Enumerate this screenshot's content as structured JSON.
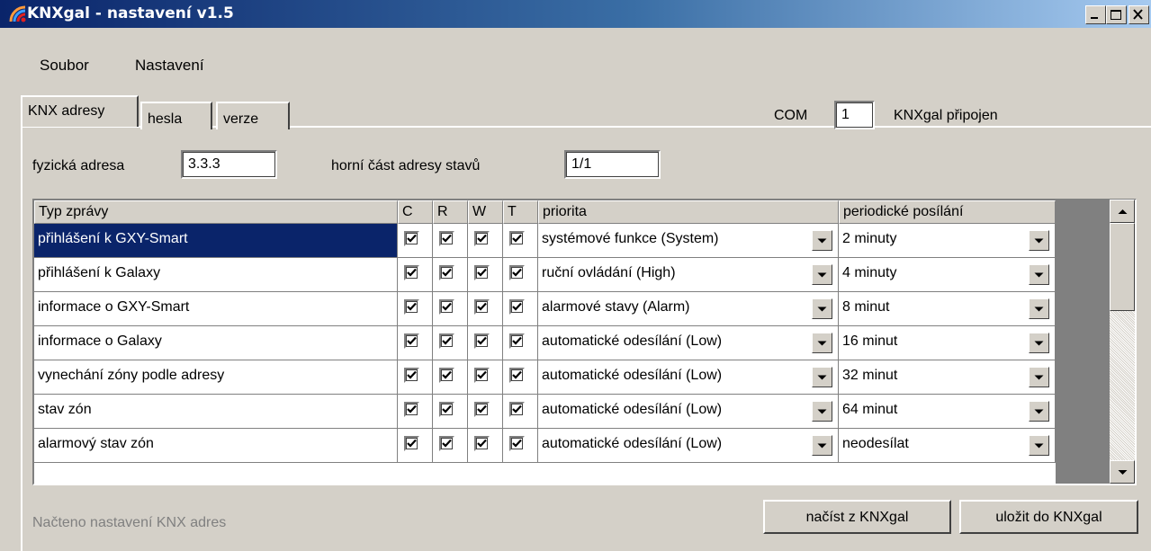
{
  "window": {
    "title": "KNXgal - nastavení v1.5"
  },
  "menu": {
    "items": [
      "Soubor",
      "Nastavení"
    ]
  },
  "tabs": [
    {
      "label": "KNX adresy",
      "active": true
    },
    {
      "label": "hesla",
      "active": false
    },
    {
      "label": "verze",
      "active": false
    }
  ],
  "connection": {
    "com_label": "COM",
    "com_value": "1",
    "status": "KNXgal připojen"
  },
  "fields": {
    "physical_address": {
      "label": "fyzická adresa",
      "value": "3.3.3"
    },
    "state_address_top": {
      "label": "horní část adresy stavů",
      "value": "1/1"
    }
  },
  "grid": {
    "columns": [
      "Typ zprávy",
      "C",
      "R",
      "W",
      "T",
      "priorita",
      "periodické posílání"
    ],
    "rows": [
      {
        "type": "přihlášení k GXY-Smart",
        "C": true,
        "R": true,
        "W": true,
        "T": true,
        "priority": "systémové funkce (System)",
        "period": "2 minuty",
        "selected": true
      },
      {
        "type": "přihlášení k Galaxy",
        "C": true,
        "R": true,
        "W": true,
        "T": true,
        "priority": "ruční ovládání (High)",
        "period": "4 minuty",
        "selected": false
      },
      {
        "type": "informace o GXY-Smart",
        "C": true,
        "R": true,
        "W": true,
        "T": true,
        "priority": "alarmové stavy (Alarm)",
        "period": "8 minut",
        "selected": false
      },
      {
        "type": "informace o Galaxy",
        "C": true,
        "R": true,
        "W": true,
        "T": true,
        "priority": "automatické odesílání (Low)",
        "period": "16 minut",
        "selected": false
      },
      {
        "type": "vynechání zóny podle adresy",
        "C": true,
        "R": true,
        "W": true,
        "T": true,
        "priority": "automatické odesílání (Low)",
        "period": "32 minut",
        "selected": false
      },
      {
        "type": "stav zón",
        "C": true,
        "R": true,
        "W": true,
        "T": true,
        "priority": "automatické odesílání (Low)",
        "period": "64 minut",
        "selected": false
      },
      {
        "type": "alarmový stav zón",
        "C": true,
        "R": true,
        "W": true,
        "T": true,
        "priority": "automatické odesílání (Low)",
        "period": "neodesílat",
        "selected": false
      }
    ]
  },
  "buttons": {
    "load": "načíst z KNXgal",
    "save": "uložit do KNXgal"
  },
  "status": {
    "text": "Načteno nastavení KNX adres"
  },
  "colors": {
    "title_start": "#0a246a",
    "title_end": "#a6caf0",
    "selection": "#0a246a",
    "face": "#d4d0c8"
  },
  "icons": [
    "app-icon",
    "minimize-icon",
    "maximize-icon",
    "close-icon",
    "checkmark-icon",
    "dropdown-arrow-icon",
    "scroll-up-icon",
    "scroll-down-icon"
  ]
}
